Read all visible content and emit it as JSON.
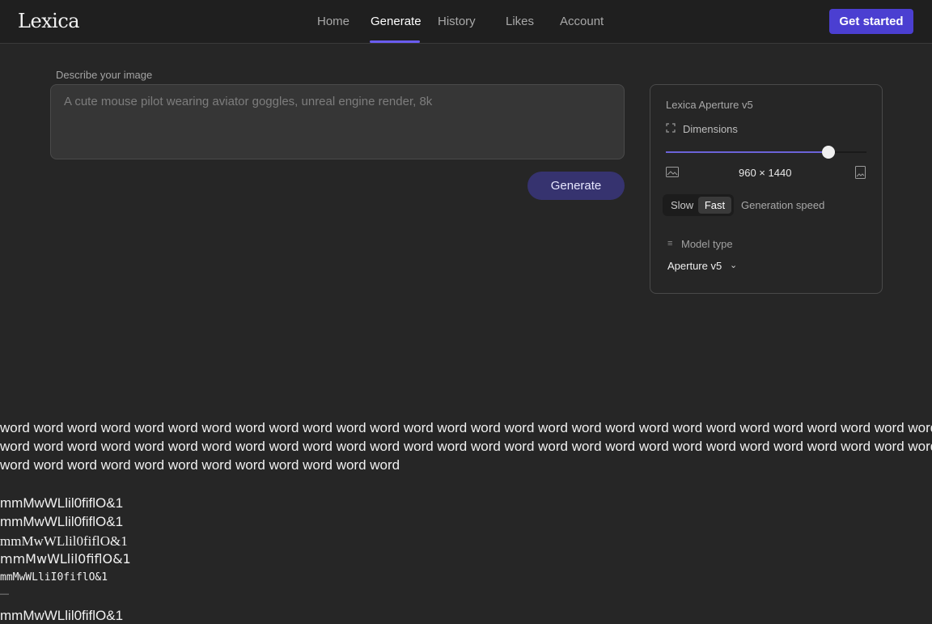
{
  "header": {
    "logo": "Lexica",
    "nav": [
      {
        "label": "Home",
        "active": false
      },
      {
        "label": "Generate",
        "active": true
      },
      {
        "label": "History",
        "active": false
      },
      {
        "label": "Likes",
        "active": false
      },
      {
        "label": "Account",
        "active": false
      }
    ],
    "cta_label": "Get started"
  },
  "prompt": {
    "label": "Describe your image",
    "placeholder": "A cute mouse pilot wearing aviator goggles, unreal engine render, 8k",
    "value": "",
    "generate_label": "Generate"
  },
  "settings": {
    "model_name": "Lexica Aperture v5",
    "dimensions_label": "Dimensions",
    "dimensions_value": "960 × 1440",
    "slider_fraction": 0.81,
    "speed": {
      "slow_label": "Slow",
      "fast_label": "Fast",
      "selected": "Fast",
      "caption": "Generation speed"
    },
    "model_type_label": "Model type",
    "model_selected": "Aperture v5"
  },
  "test_text": {
    "line1": "word word word word word word word word word word word word word word word word word word word word word word word word word word word word w",
    "line2": "word word word word word word word word word word word word word word word word word word word word word word word word word word word word w",
    "line3": "word word word word word word word word word word word word",
    "sample1": "mmMwWLlil0fiflO&1",
    "sample2": "mmMwWLlil0fiflO&1",
    "sample3": "mmMwWLlil0fiflO&1",
    "sample4": "mmMwWLlil0fiflO&1",
    "sample5": "mmMwWLliI0fiflO&1",
    "sample6": "—",
    "sample7": "mmMwWLlil0fiflO&1"
  },
  "colors": {
    "background": "#262626",
    "header": "#1f1f1f",
    "accent": "#4b3fd1",
    "generate_button": "#36336f"
  }
}
